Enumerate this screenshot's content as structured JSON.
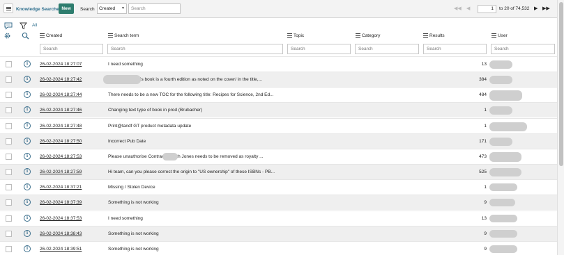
{
  "toolbar": {
    "title": "Knowledge Searches",
    "new_label": "New",
    "search_label": "Search",
    "search_field": "Created",
    "search_placeholder": "Search"
  },
  "pager": {
    "current_page": "1",
    "range_text": "to 20 of 74,532"
  },
  "filter": {
    "all_label": "All"
  },
  "columns": {
    "created": "Created",
    "search_term": "Search term",
    "topic": "Topic",
    "category": "Category",
    "results": "Results",
    "user": "User"
  },
  "column_search_placeholder": "Search",
  "rows": [
    {
      "created": "26-02-2024 18:27:07",
      "term": "I need something",
      "results": "13"
    },
    {
      "created": "26-02-2024 18:27:42",
      "term": "is book is a fourth edition as noted on the cover/ in the title,...",
      "results": "384"
    },
    {
      "created": "26-02-2024 18:27:44",
      "term": "There needs to be a new TOC for the following title: Recipes for Science, 2nd Ed...",
      "results": "484"
    },
    {
      "created": "26-02-2024 18:27:46",
      "term": "Changing text type of book in prod (Brubacher)",
      "results": "1"
    },
    {
      "created": "26-02-2024 18:27:48",
      "term": "Print@tandf GT product metadata update",
      "results": "1"
    },
    {
      "created": "26-02-2024 18:27:50",
      "term": "Incorrect Pub Date",
      "results": "171"
    },
    {
      "created": "26-02-2024 18:27:53",
      "term": "Please unauthorise Contract              Gareth Jones needs to be removed as royalty ...",
      "results": "473"
    },
    {
      "created": "26-02-2024 18:27:59",
      "term": "Hi team, can you please correct the origin to \"US ownership\" of these ISBNs - PB...",
      "results": "525"
    },
    {
      "created": "26-02-2024 18:37:21",
      "term": "Missing / Stolen Device",
      "results": "1"
    },
    {
      "created": "26-02-2024 18:37:39",
      "term": "Something is not working",
      "results": "9"
    },
    {
      "created": "26-02-2024 18:37:53",
      "term": "I need something",
      "results": "13"
    },
    {
      "created": "26-02-2024 18:38:43",
      "term": "Something is not working",
      "results": "9"
    },
    {
      "created": "26-02-2024 18:39:51",
      "term": "Something is not working",
      "results": "9"
    }
  ],
  "icons": {
    "info": "info-circle-icon",
    "menu": "hamburger-menu-icon",
    "filter": "filter-funnel-icon",
    "settings": "gear-icon",
    "search": "search-icon",
    "chat": "chat-bubble-icon"
  },
  "colors": {
    "accent": "#2c6d8c",
    "new_button": "#2e7d6e",
    "alt_row": "#efefef"
  }
}
